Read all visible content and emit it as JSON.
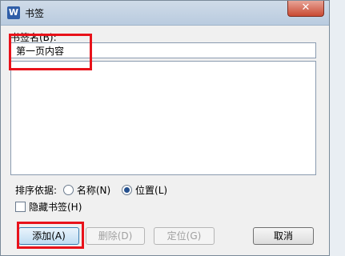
{
  "dialog": {
    "app_icon_letter": "W",
    "title": "书签",
    "close_label": "✕"
  },
  "bookmark_name": {
    "label": "书签名(B):",
    "value": "第一页内容"
  },
  "sort": {
    "label": "排序依据:",
    "options": [
      {
        "label": "名称(N)",
        "selected": false
      },
      {
        "label": "位置(L)",
        "selected": true
      }
    ]
  },
  "hidden_bookmarks": {
    "label": "隐藏书签(H)",
    "checked": false
  },
  "buttons": {
    "add": "添加(A)",
    "delete": "删除(D)",
    "goto": "定位(G)",
    "cancel": "取消"
  },
  "highlight_color": "#e8121a"
}
